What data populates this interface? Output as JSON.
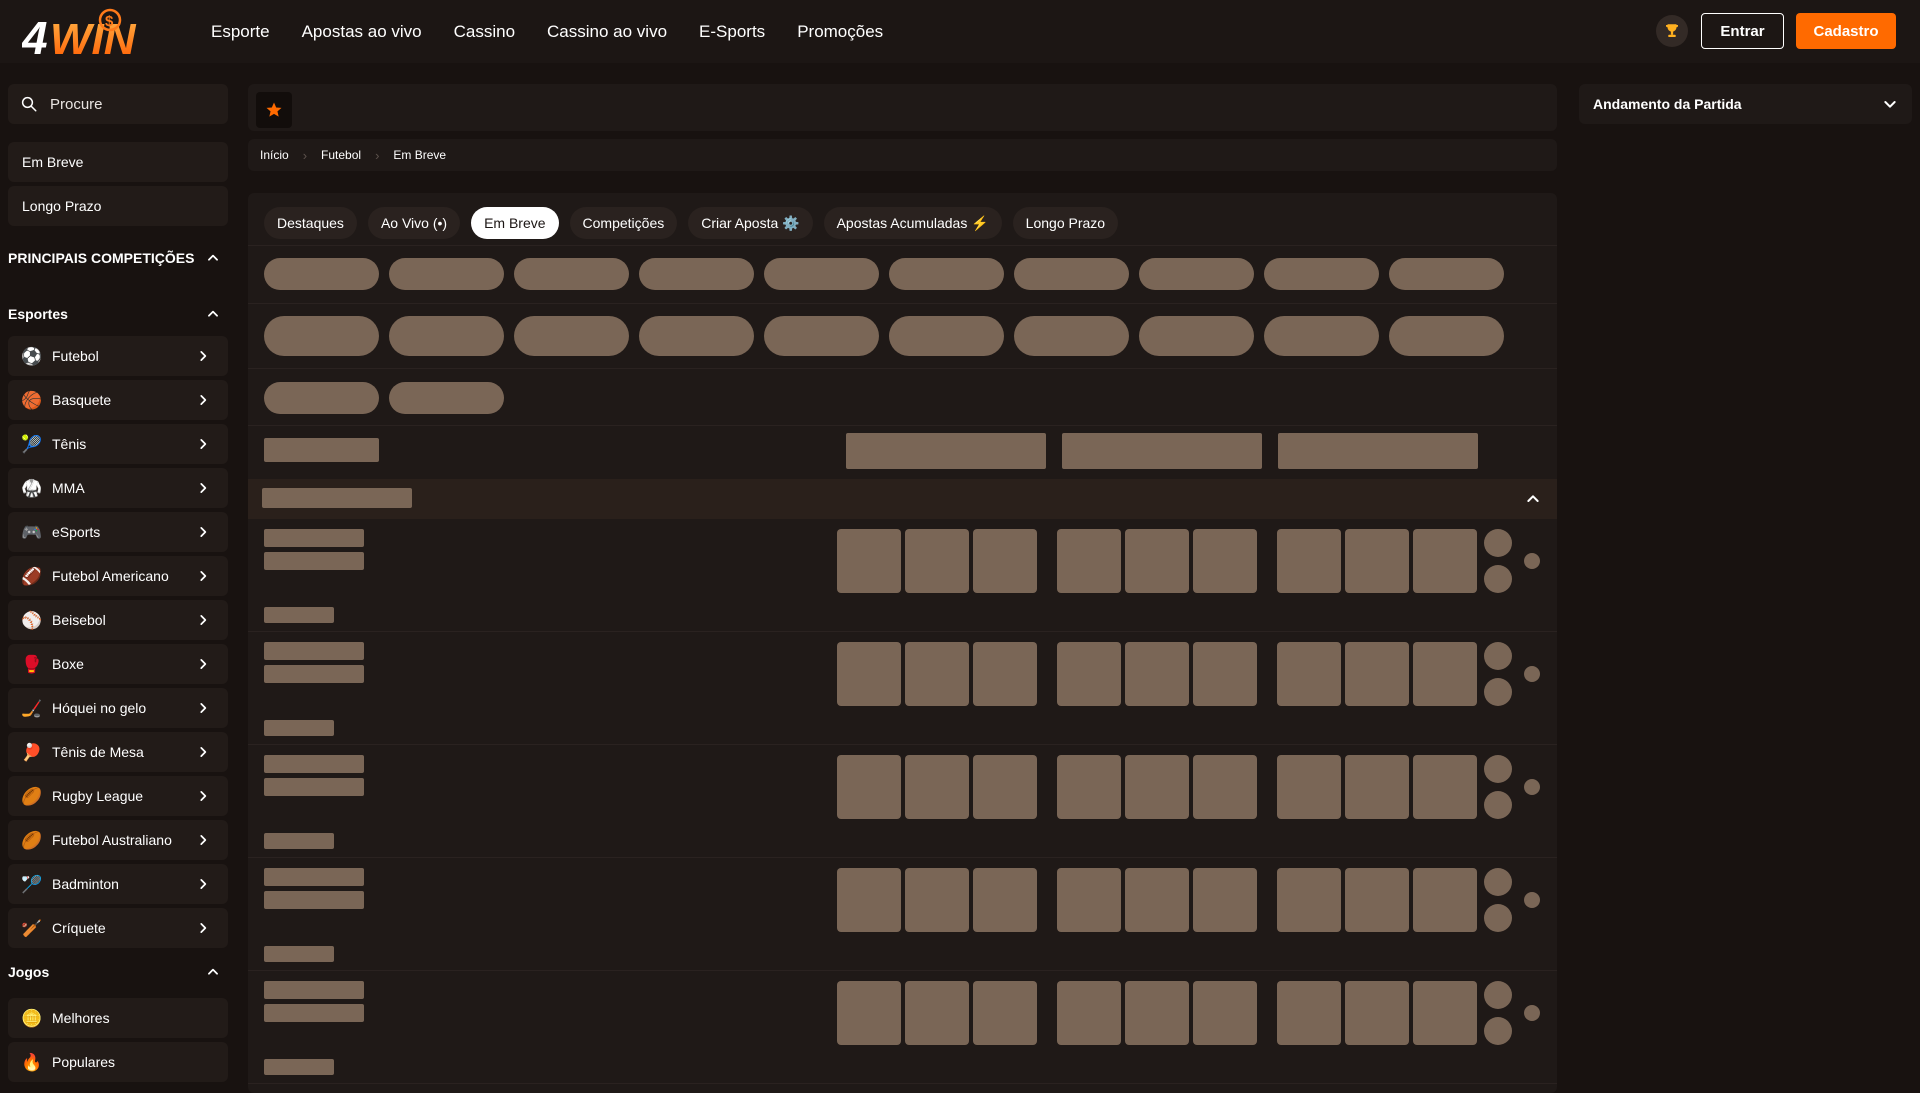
{
  "header": {
    "logo_text": "4WIN",
    "nav": [
      "Esporte",
      "Apostas ao vivo",
      "Cassino",
      "Cassino ao vivo",
      "E-Sports",
      "Promoções"
    ],
    "login_label": "Entrar",
    "signup_label": "Cadastro",
    "trophy_icon": "trophy-icon"
  },
  "colors": {
    "accent": "#ff6a00",
    "background": "#181210",
    "panel": "#1f1917",
    "skeleton": "#7a6656"
  },
  "sidebar": {
    "search_placeholder": "Procure",
    "quick_links": [
      "Em Breve",
      "Longo Prazo"
    ],
    "competitions_title": "PRINCIPAIS COMPETIÇÕES",
    "sports_title": "Esportes",
    "sports": [
      {
        "label": "Futebol",
        "icon": "⚽"
      },
      {
        "label": "Basquete",
        "icon": "🏀"
      },
      {
        "label": "Tênis",
        "icon": "🎾"
      },
      {
        "label": "MMA",
        "icon": "🥋"
      },
      {
        "label": "eSports",
        "icon": "🎮"
      },
      {
        "label": "Futebol Americano",
        "icon": "🏈"
      },
      {
        "label": "Beisebol",
        "icon": "⚾"
      },
      {
        "label": "Boxe",
        "icon": "🥊"
      },
      {
        "label": "Hóquei no gelo",
        "icon": "🏒"
      },
      {
        "label": "Tênis de Mesa",
        "icon": "🏓"
      },
      {
        "label": "Rugby League",
        "icon": "🏉"
      },
      {
        "label": "Futebol Australiano",
        "icon": "🏉"
      },
      {
        "label": "Badminton",
        "icon": "🏸"
      },
      {
        "label": "Críquete",
        "icon": "🏏"
      }
    ],
    "games_title": "Jogos",
    "games": [
      {
        "label": "Melhores",
        "icon": "🪙"
      },
      {
        "label": "Populares",
        "icon": "🔥"
      }
    ]
  },
  "main": {
    "breadcrumb": [
      "Início",
      "Futebol",
      "Em Breve"
    ],
    "tabs": [
      "Destaques",
      "Ao Vivo (•)",
      "Em Breve",
      "Competições",
      "Criar Aposta ⚙️",
      "Apostas Acumuladas ⚡",
      "Longo Prazo"
    ],
    "active_tab": "Em Breve"
  },
  "right_panel": {
    "title": "Andamento da Partida"
  }
}
